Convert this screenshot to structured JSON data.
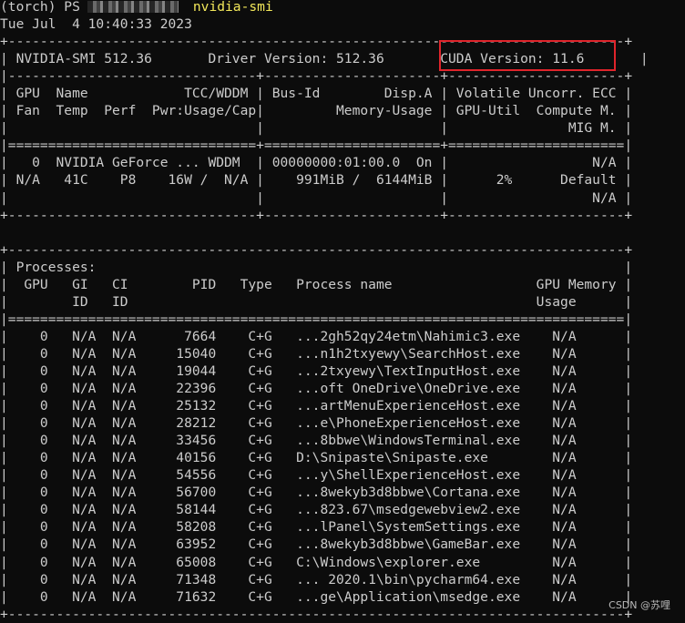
{
  "prompt": {
    "shell": "(torch) PS",
    "command": "nvidia-smi"
  },
  "timestamp": "Tue Jul  4 10:40:33 2023",
  "smi": {
    "border_top": "+-----------------------------------------------------------------------------+",
    "header_line": "| NVIDIA-SMI 512.36       Driver Version: 512.36       CUDA Version: 11.6       |",
    "separator_dash": "|-------------------------------+----------------------+----------------------+",
    "col_header_1": "| GPU  Name            TCC/WDDM | Bus-Id        Disp.A | Volatile Uncorr. ECC |",
    "col_header_2": "| Fan  Temp  Perf  Pwr:Usage/Cap|         Memory-Usage | GPU-Util  Compute M. |",
    "col_header_3": "|                               |                      |               MIG M. |",
    "separator_eq": "|===============================+======================+======================|",
    "gpu_row_1": "|   0  NVIDIA GeForce ... WDDM  | 00000000:01:00.0  On |                  N/A |",
    "gpu_row_2": "| N/A   41C    P8    16W /  N/A |    991MiB /  6144MiB |      2%      Default |",
    "gpu_row_3": "|                               |                      |                  N/A |",
    "border_bottom": "+-------------------------------+----------------------+----------------------+"
  },
  "processes": {
    "border_top": "+-----------------------------------------------------------------------------+",
    "title_line": "| Processes:                                                                  |",
    "header_1": "|  GPU   GI   CI        PID   Type   Process name                  GPU Memory |",
    "header_2": "|        ID   ID                                                   Usage      |",
    "separator_eq": "|=============================================================================|",
    "rows": [
      "|    0   N/A  N/A      7664    C+G   ...2gh52qy24etm\\Nahimic3.exe    N/A      |",
      "|    0   N/A  N/A     15040    C+G   ...n1h2txyewy\\SearchHost.exe    N/A      |",
      "|    0   N/A  N/A     19044    C+G   ...2txyewy\\TextInputHost.exe    N/A      |",
      "|    0   N/A  N/A     22396    C+G   ...oft OneDrive\\OneDrive.exe    N/A      |",
      "|    0   N/A  N/A     25132    C+G   ...artMenuExperienceHost.exe    N/A      |",
      "|    0   N/A  N/A     28212    C+G   ...e\\PhoneExperienceHost.exe    N/A      |",
      "|    0   N/A  N/A     33456    C+G   ...8bbwe\\WindowsTerminal.exe    N/A      |",
      "|    0   N/A  N/A     40156    C+G   D:\\Snipaste\\Snipaste.exe        N/A      |",
      "|    0   N/A  N/A     54556    C+G   ...y\\ShellExperienceHost.exe    N/A      |",
      "|    0   N/A  N/A     56700    C+G   ...8wekyb3d8bbwe\\Cortana.exe    N/A      |",
      "|    0   N/A  N/A     58144    C+G   ...823.67\\msedgewebview2.exe    N/A      |",
      "|    0   N/A  N/A     58208    C+G   ...lPanel\\SystemSettings.exe    N/A      |",
      "|    0   N/A  N/A     63952    C+G   ...8wekyb3d8bbwe\\GameBar.exe    N/A      |",
      "|    0   N/A  N/A     65008    C+G   C:\\Windows\\explorer.exe         N/A      |",
      "|    0   N/A  N/A     71348    C+G   ... 2020.1\\bin\\pycharm64.exe    N/A      |",
      "|    0   N/A  N/A     71632    C+G   ...ge\\Application\\msedge.exe    N/A      |"
    ],
    "border_bottom": "+-----------------------------------------------------------------------------+"
  },
  "watermark": "CSDN @苏哩"
}
